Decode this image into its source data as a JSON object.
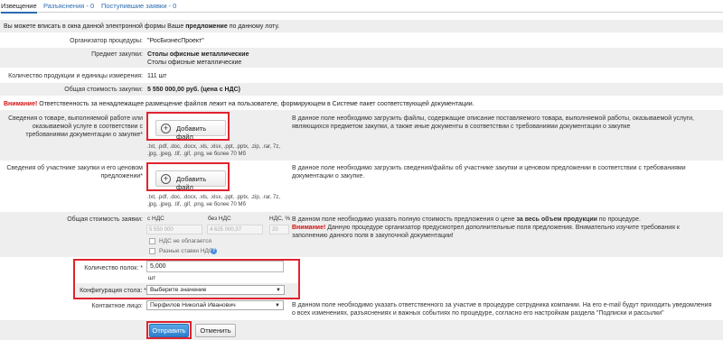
{
  "tabs": [
    {
      "label": "Извещение"
    },
    {
      "label": "Разъяснения - 0"
    },
    {
      "label": "Поступившие заявки - 0"
    }
  ],
  "intro": {
    "prefix": "Вы можете вписать в окна данной электронной формы Ваше ",
    "bold": "предложение",
    "suffix": " по данному лоту."
  },
  "fields": {
    "organizer": {
      "label": "Организатор процедуры:",
      "value": "\"РосБизнесПроект\""
    },
    "subject": {
      "label": "Предмет закупки:",
      "value_bold": "Столы офисные металлические",
      "value_sub": "Столы офисные металлические"
    },
    "quantity_units": {
      "label": "Количество продукции и единицы измерения:",
      "value": "111 шт"
    },
    "total_cost": {
      "label": "Общая стоимость закупки:",
      "value": "5 550 000,00 руб. (цена с НДС)"
    }
  },
  "warning": {
    "title": "Внимание!",
    "text": " Ответственность за ненадлежащее размещение файлов лежит на пользователе, формирующем в Системе пакет соответствующей документации."
  },
  "upload_goods": {
    "label": "Сведения о товаре, выполняемой работе или оказываемой услуге в соответствии с требованиями документации о закупке*",
    "button": "Добавить файл",
    "formats": ".txt, .pdf, .doc, .docx, .xls, .xlsx, .ppt, .pptx, .zip, .rar, 7z, .jpg, .jpeg, .tif, .gif, .png, не более 70 Мб",
    "hint": "В данное поле необходимо загрузить файлы, содержащие описание поставляемого товара, выполняемой работы, оказываемой услуги, являющихся предметом закупки, а также иные документы в соответствии с требованиями документации о закупке"
  },
  "upload_participant": {
    "label": "Сведения об участнике закупки и его ценовом предложении*",
    "button": "Добавить файл",
    "formats": ".txt, .pdf, .doc, .docx, .xls, .xlsx, .ppt, .pptx, .zip, .rar, 7z, .jpg, .jpeg, .tif, .gif, .png, не более 70 Мб",
    "hint": "В данное поле необходимо загрузить сведения/файлы об участнике закупки и ценовом предложении в соответствии с требованиями документации о закупке."
  },
  "bid_cost": {
    "label": "Общая стоимость заявки:",
    "col_with_vat": "с НДС",
    "col_without_vat": "без НДС",
    "col_vat_rate": "НДС, %",
    "with_vat_value": "5 550 000",
    "without_vat_value": "4 625 000,37",
    "vat_rate_value": "20",
    "no_vat_label": "НДС не облагается",
    "diff_rates_label": "Разные ставки НДС",
    "hint_prefix": "В данном поле необходимо указать полную стоимость предложения о цене ",
    "hint_bold": "за весь объем продукции",
    "hint_suffix": " по процедуре.",
    "hint_warning_title": "Внимание!",
    "hint_warning_text": " Данную процедуре организатор предусмотрел дополнительные поля предложения. Внимательно изучите требования к заполнению данного поля в закупочной документации!"
  },
  "shelf_count": {
    "label": "Количество полок: *",
    "value": "5,000",
    "unit": "шт"
  },
  "table_config": {
    "label": "Конфигурация стола: *",
    "selected": "Выберите значение"
  },
  "contact": {
    "label": "Контактное лицо:",
    "selected": "Перфилов Николай Иванович",
    "hint": "В данном поле необходимо указать ответственного за участие в процедуре сотрудника компании. На его e-mail будут приходить уведомления о всех изменениях, разъяснениях и важных событиях по процедуре, согласно его настройкам раздела \"Подписки и рассылки\""
  },
  "actions": {
    "submit": "Отправить",
    "cancel": "Отменить"
  },
  "colors": {
    "highlight": "#e0232f",
    "link": "#2b6cb0",
    "warning": "#d11111",
    "primary_button": "#2d7fcf"
  }
}
